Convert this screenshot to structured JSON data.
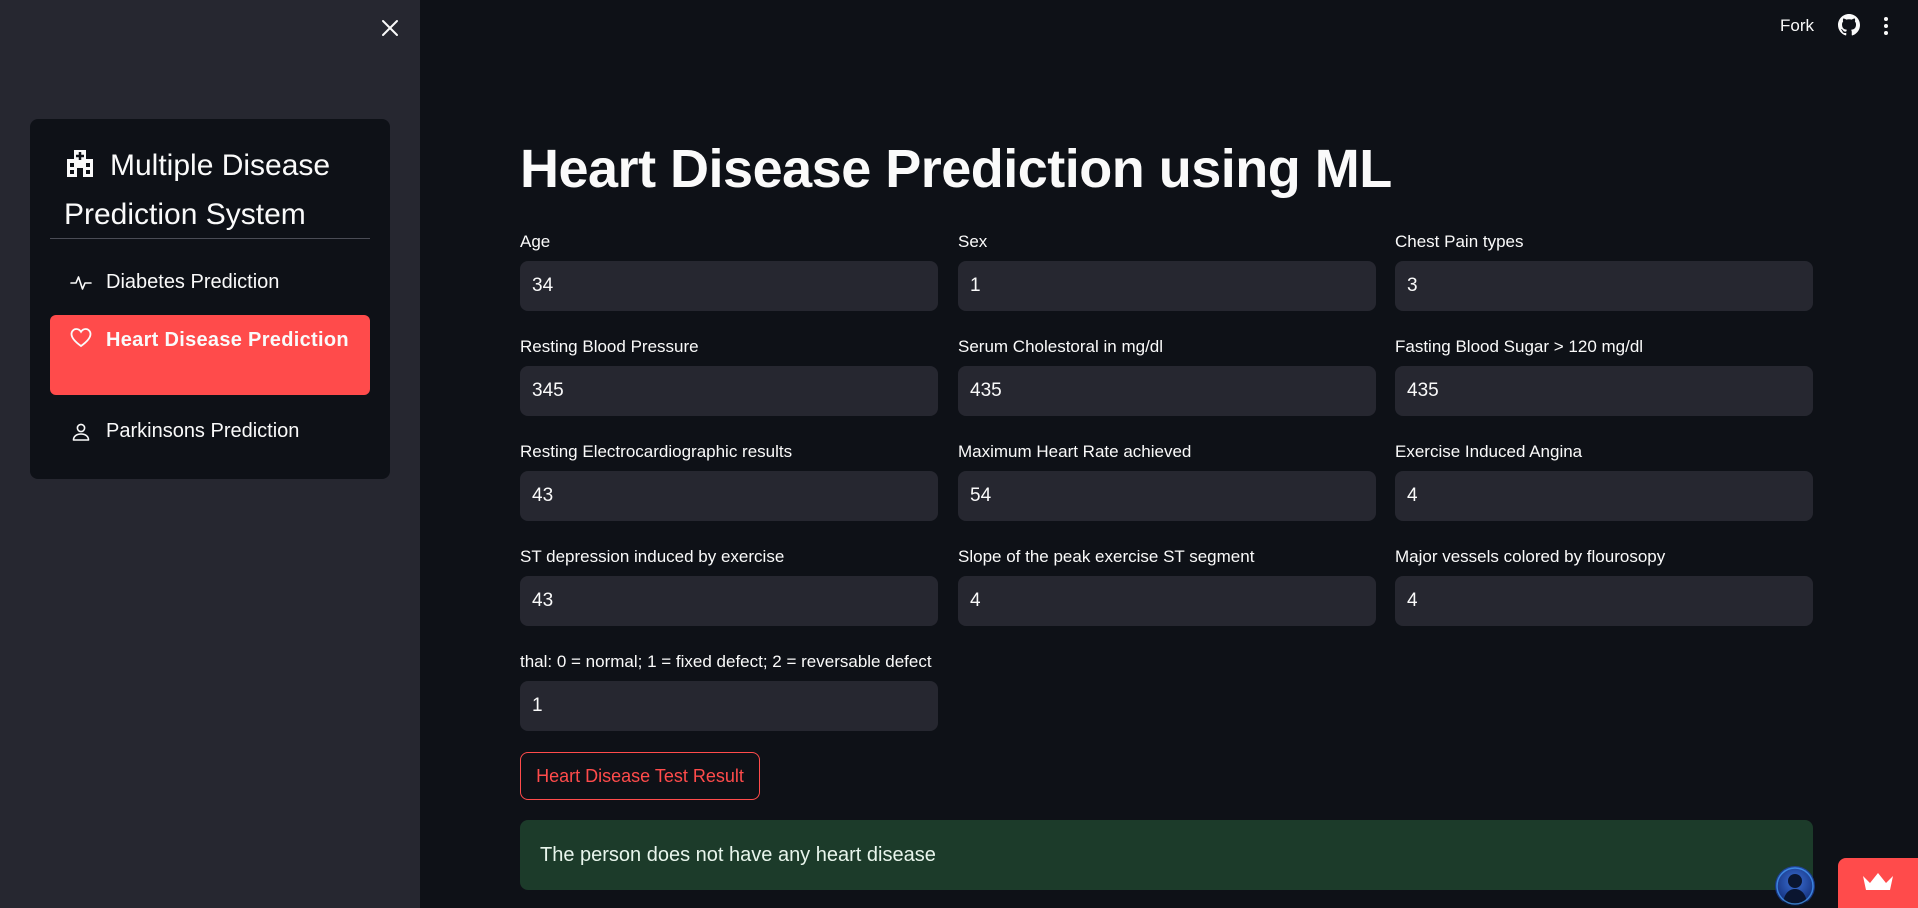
{
  "sidebar": {
    "close_icon": "close-icon",
    "menu_title": "Multiple Disease Prediction System",
    "title_icon": "hospital-icon",
    "items": [
      {
        "label": "Diabetes Prediction",
        "icon": "activity-icon",
        "active": false
      },
      {
        "label": "Heart Disease Prediction",
        "icon": "heart-icon",
        "active": true
      },
      {
        "label": "Parkinsons Prediction",
        "icon": "person-icon",
        "active": false
      }
    ],
    "active_color": "#ff4b4b"
  },
  "toolbar": {
    "fork_label": "Fork",
    "github_icon": "github-icon",
    "menu_icon": "kebab-menu-icon"
  },
  "main": {
    "title": "Heart Disease Prediction using ML",
    "fields": [
      {
        "label": "Age",
        "value": "34"
      },
      {
        "label": "Sex",
        "value": "1"
      },
      {
        "label": "Chest Pain types",
        "value": "3"
      },
      {
        "label": "Resting Blood Pressure",
        "value": "345"
      },
      {
        "label": "Serum Cholestoral in mg/dl",
        "value": "435"
      },
      {
        "label": "Fasting Blood Sugar > 120 mg/dl",
        "value": "435"
      },
      {
        "label": "Resting Electrocardiographic results",
        "value": "43"
      },
      {
        "label": "Maximum Heart Rate achieved",
        "value": "54"
      },
      {
        "label": "Exercise Induced Angina",
        "value": "4"
      },
      {
        "label": "ST depression induced by exercise",
        "value": "43"
      },
      {
        "label": "Slope of the peak exercise ST segment",
        "value": "4"
      },
      {
        "label": "Major vessels colored by flourosopy",
        "value": "4"
      },
      {
        "label": "thal: 0 = normal; 1 = fixed defect; 2 = reversable defect",
        "value": "1"
      }
    ],
    "button_label": "Heart Disease Test Result",
    "result_message": "The person does not have any heart disease",
    "result_color": "#1c3b2a"
  }
}
